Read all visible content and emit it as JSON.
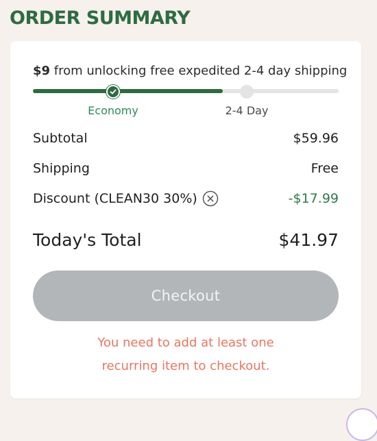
{
  "header": {
    "title": "ORDER SUMMARY"
  },
  "shipping_progress": {
    "amount": "$9",
    "message": " from unlocking free expedited 2-4 day shipping",
    "progress_fraction": 0.62,
    "steps": [
      {
        "label": "Economy",
        "state": "complete"
      },
      {
        "label": "2-4 Day",
        "state": "incomplete"
      }
    ]
  },
  "summary": {
    "subtotal": {
      "label": "Subtotal",
      "value": "$59.96"
    },
    "shipping": {
      "label": "Shipping",
      "value": "Free"
    },
    "discount": {
      "label": "Discount (CLEAN30 30%)",
      "value": "-$17.99"
    },
    "total": {
      "label": "Today's Total",
      "value": "$41.97"
    }
  },
  "checkout": {
    "label": "Checkout",
    "enabled": false,
    "error_line1": "You need to add at least one",
    "error_line2": "recurring item to checkout."
  },
  "colors": {
    "brand_green": "#2e6b43",
    "discount_green": "#2e7a4a",
    "error_orange": "#e8765f",
    "button_disabled": "#b2b6b8",
    "background": "#f6f1ec"
  },
  "icons": {
    "step_complete": "check-icon",
    "remove_discount": "close-circle-icon"
  }
}
